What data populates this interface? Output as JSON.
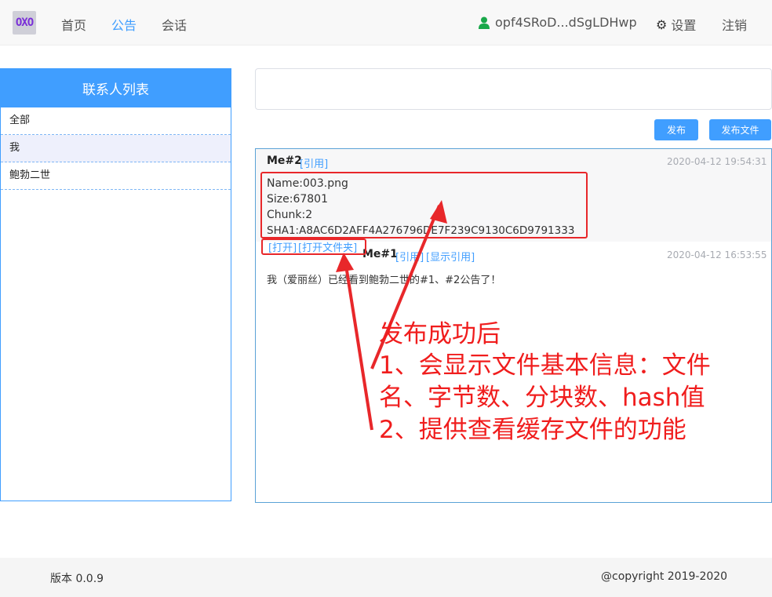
{
  "nav": {
    "logo": "OXO",
    "home": "首页",
    "announcements": "公告",
    "chat": "会话",
    "user": "opf4SRoD...dSgLDHwp",
    "settings": "设置",
    "logout": "注销"
  },
  "sidebar": {
    "title": "联系人列表",
    "items": [
      {
        "label": "全部"
      },
      {
        "label": "我"
      },
      {
        "label": "鲍勃二世"
      }
    ]
  },
  "compose": {
    "placeholder": "",
    "publish": "发布",
    "publish_file": "发布文件"
  },
  "posts": [
    {
      "author": "Me#2",
      "quote": "[引用]",
      "time": "2020-04-12 19:54:31",
      "file": {
        "name": "Name:003.png",
        "size": "Size:67801",
        "chunk": "Chunk:2",
        "sha1": "SHA1:A8AC6D2AFF4A276796DE7F239C9130C6D9791333"
      },
      "open": "[打开]",
      "open_folder": "[打开文件夹]"
    },
    {
      "author": "Me#1",
      "quote": "[引用]",
      "show_quote": "[显示引用]",
      "time": "2020-04-12 16:53:55",
      "message": "我（爱丽丝）已经看到鲍勃二世的#1、#2公告了！"
    }
  ],
  "annotation": {
    "line1": "发布成功后",
    "line2": "1、会显示文件基本信息：文件",
    "line3": "名、字节数、分块数、hash值",
    "line4": "2、提供查看缓存文件的功能",
    "color": "#f01d1d"
  },
  "footer": {
    "version": "版本 0.0.9",
    "copyright": "@copyright 2019-2020"
  },
  "colors": {
    "accent": "#409eff",
    "annotation_red": "#e8272a"
  }
}
